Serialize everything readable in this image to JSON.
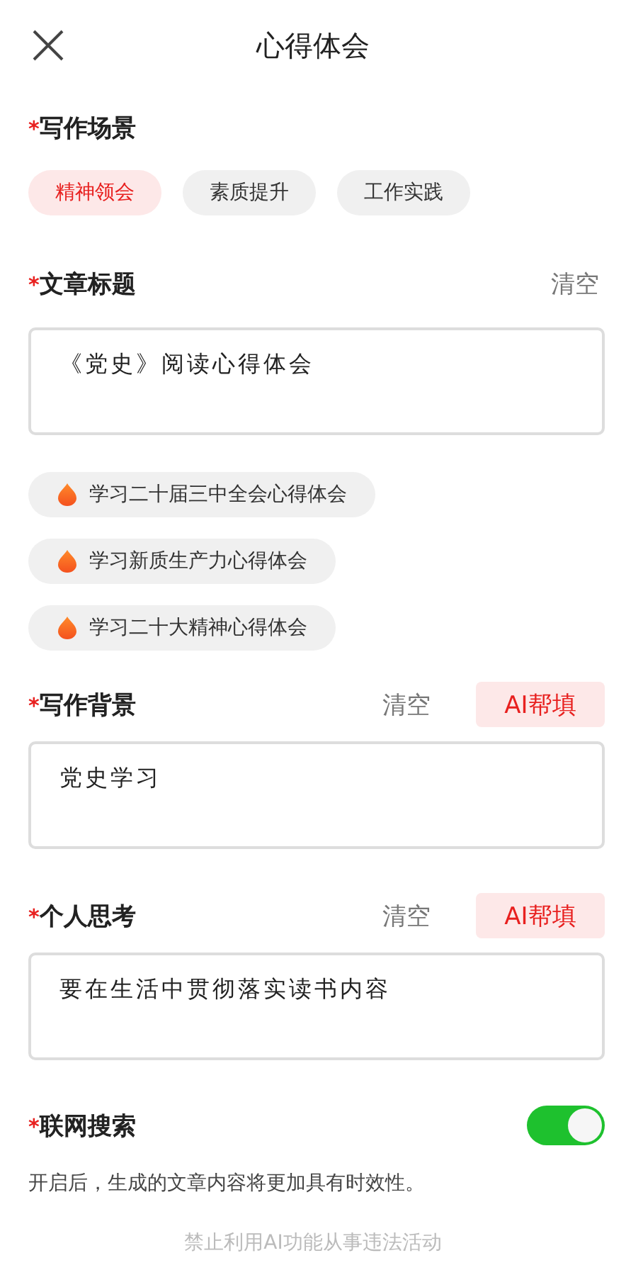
{
  "header": {
    "title": "心得体会"
  },
  "sections": [
    {
      "kind": "chips",
      "mark": "*",
      "label": "写作场景",
      "chips": [
        {
          "label": "精神领会",
          "selected": true
        },
        {
          "label": "素质提升",
          "selected": false
        },
        {
          "label": "工作实践",
          "selected": false
        }
      ]
    },
    {
      "kind": "field",
      "mark": "*",
      "label": "文章标题",
      "clear": "清空",
      "value": "《党史》阅读心得体会",
      "suggestions": [
        "学习二十届三中全会心得体会",
        "学习新质生产力心得体会",
        "学习二十大精神心得体会"
      ]
    },
    {
      "kind": "field",
      "mark": "*",
      "label": "写作背景",
      "clear": "清空",
      "ai": "AI帮填",
      "value": "党史学习"
    },
    {
      "kind": "field",
      "mark": "*",
      "label": "个人思考",
      "clear": "清空",
      "ai": "AI帮填",
      "value": "要在生活中贯彻落实读书内容"
    },
    {
      "kind": "toggle",
      "mark": "*",
      "label": "联网搜索",
      "on": true,
      "note": "开启后，生成的文章内容将更加具有时效性。"
    }
  ],
  "footer": "禁止利用AI功能从事违法活动"
}
